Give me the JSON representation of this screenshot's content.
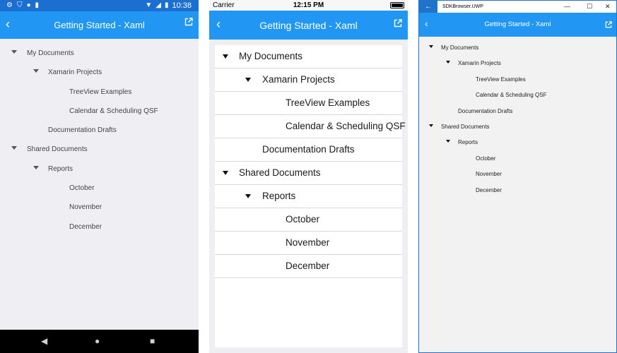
{
  "app": {
    "title": "Getting Started - Xaml",
    "accent": "#2196f3"
  },
  "android": {
    "status_time": "10:38",
    "status_icons_left": [
      "gear-icon",
      "shield-icon",
      "circle-icon",
      "sd-card-icon"
    ],
    "status_icons_right": [
      "wifi-icon",
      "signal-icon",
      "battery-icon"
    ],
    "nav_buttons": [
      "back-triangle-icon",
      "home-circle-icon",
      "recents-square-icon"
    ]
  },
  "ios": {
    "carrier": "Carrier",
    "time": "12:15 PM"
  },
  "uwp": {
    "window_title": "SDKBrowser.UWP",
    "window_controls": [
      "minimize-icon",
      "maximize-icon",
      "close-icon"
    ]
  },
  "tree": [
    {
      "label": "My Documents",
      "level": 0,
      "expanded": true
    },
    {
      "label": "Xamarin Projects",
      "level": 1,
      "expanded": true
    },
    {
      "label": "TreeView Examples",
      "level": 2
    },
    {
      "label": "Calendar & Scheduling QSF",
      "level": 2
    },
    {
      "label": "Documentation Drafts",
      "level": 1
    },
    {
      "label": "Shared Documents",
      "level": 0,
      "expanded": true
    },
    {
      "label": "Reports",
      "level": 1,
      "expanded": true
    },
    {
      "label": "October",
      "level": 2
    },
    {
      "label": "November",
      "level": 2
    },
    {
      "label": "December",
      "level": 2
    }
  ]
}
